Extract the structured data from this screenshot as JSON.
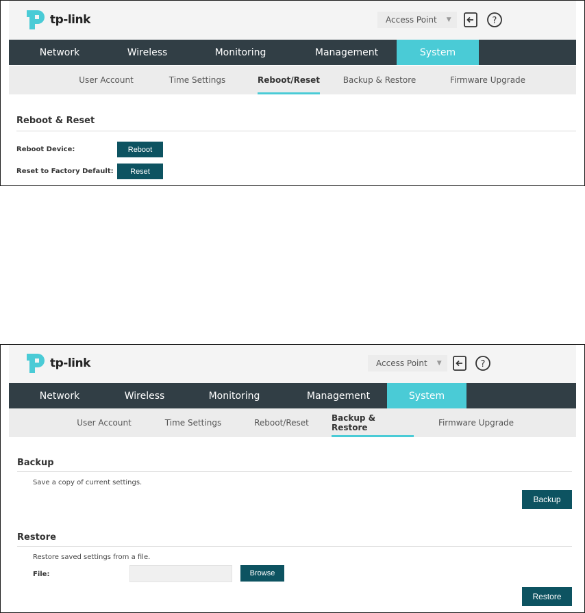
{
  "brand": {
    "name": "tp-link"
  },
  "colors": {
    "nav_bg": "#313e45",
    "accent": "#4acbd6",
    "button": "#0d5361"
  },
  "header": {
    "mode": "Access Point",
    "logout_icon": "logout-icon",
    "help_icon": "help-icon"
  },
  "topnav": [
    "Network",
    "Wireless",
    "Monitoring",
    "Management",
    "System"
  ],
  "subnav": [
    "User Account",
    "Time Settings",
    "Reboot/Reset",
    "Backup & Restore",
    "Firmware Upgrade"
  ],
  "panel1": {
    "active_top": "System",
    "active_sub": "Reboot/Reset",
    "section_title": "Reboot & Reset",
    "reboot_label": "Reboot Device:",
    "reboot_button": "Reboot",
    "reset_label": "Reset to Factory Default:",
    "reset_button": "Reset"
  },
  "panel2": {
    "active_top": "System",
    "active_sub": "Backup & Restore",
    "backup_title": "Backup",
    "backup_desc": "Save a copy of current settings.",
    "backup_button": "Backup",
    "restore_title": "Restore",
    "restore_desc": "Restore saved settings from a file.",
    "file_label": "File:",
    "file_value": "",
    "browse_button": "Browse",
    "restore_button": "Restore"
  }
}
